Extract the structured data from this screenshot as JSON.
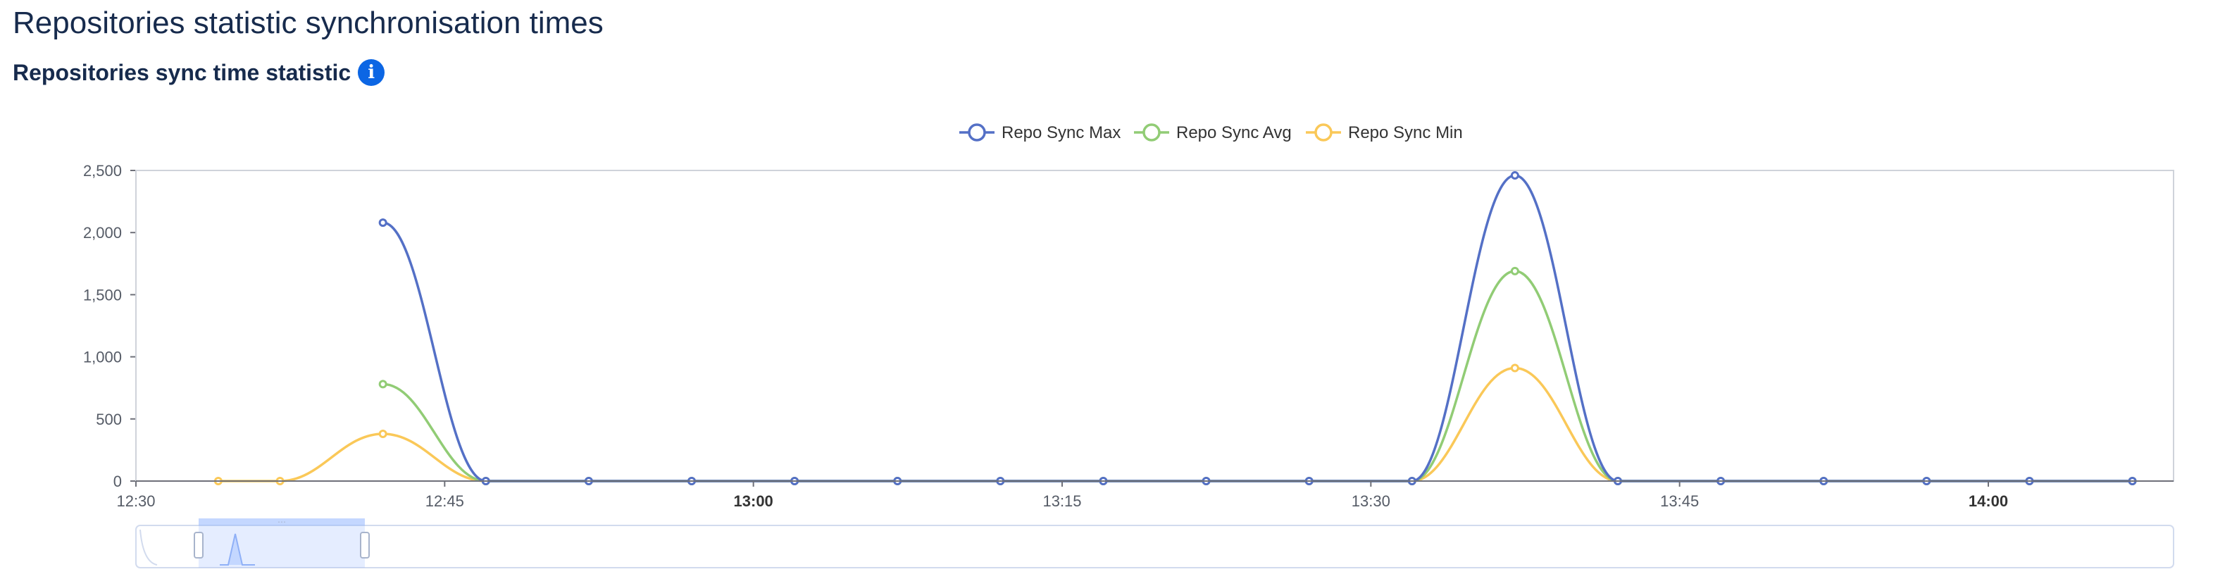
{
  "page": {
    "title": "Repositories statistic synchronisation times",
    "section_title": "Repositories sync time statistic",
    "info_icon": "info-icon"
  },
  "chart_data": {
    "type": "line",
    "x_axis": {
      "type": "time",
      "min": "12:30",
      "max": "14:09",
      "ticks": [
        {
          "label": "12:30",
          "bold": false
        },
        {
          "label": "12:45",
          "bold": false
        },
        {
          "label": "13:00",
          "bold": true
        },
        {
          "label": "13:15",
          "bold": false
        },
        {
          "label": "13:30",
          "bold": false
        },
        {
          "label": "13:45",
          "bold": false
        },
        {
          "label": "14:00",
          "bold": true
        }
      ]
    },
    "y_axis": {
      "min": 0,
      "max": 2500,
      "ticks": [
        "0",
        "500",
        "1,000",
        "1,500",
        "2,000",
        "2,500"
      ]
    },
    "x": [
      "12:34",
      "12:37",
      "12:42",
      "12:47",
      "12:52",
      "12:57",
      "13:02",
      "13:07",
      "13:12",
      "13:17",
      "13:22",
      "13:27",
      "13:32",
      "13:37",
      "13:42",
      "13:47",
      "13:52",
      "13:57",
      "14:02",
      "14:07"
    ],
    "series": [
      {
        "name": "Repo Sync Max",
        "color": "#5470c6",
        "values": [
          null,
          null,
          2080,
          0,
          0,
          0,
          0,
          0,
          0,
          0,
          0,
          0,
          0,
          2460,
          0,
          0,
          0,
          0,
          0,
          0
        ]
      },
      {
        "name": "Repo Sync Avg",
        "color": "#91cc75",
        "values": [
          null,
          null,
          780,
          0,
          0,
          0,
          0,
          0,
          0,
          0,
          0,
          0,
          0,
          1690,
          0,
          0,
          0,
          0,
          0,
          0
        ]
      },
      {
        "name": "Repo Sync Min",
        "color": "#fac858",
        "values": [
          0,
          0,
          380,
          0,
          0,
          0,
          0,
          0,
          0,
          0,
          0,
          0,
          0,
          910,
          0,
          0,
          0,
          0,
          0,
          0
        ]
      }
    ],
    "legend_position": "top-center",
    "grid": false,
    "data_zoom": {
      "start": 0.03,
      "end": 0.11
    }
  }
}
